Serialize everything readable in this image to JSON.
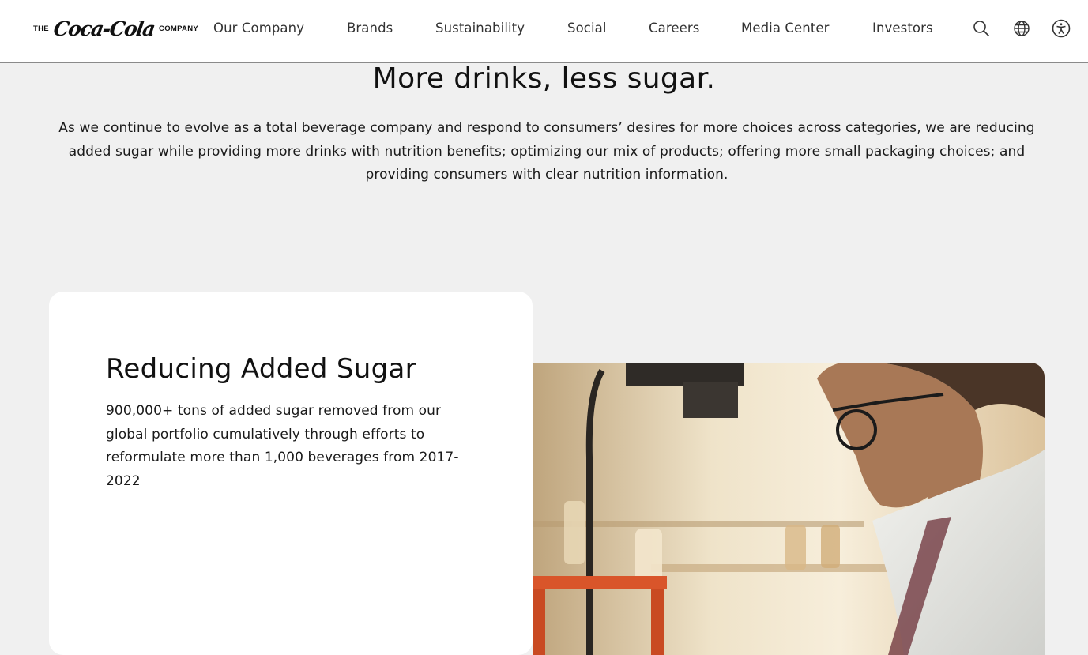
{
  "header": {
    "logo": {
      "prefix": "THE",
      "brand": "Coca-Cola",
      "suffix": "COMPANY"
    },
    "nav": [
      {
        "label": "Our Company"
      },
      {
        "label": "Brands"
      },
      {
        "label": "Sustainability"
      },
      {
        "label": "Social"
      },
      {
        "label": "Careers"
      },
      {
        "label": "Media Center"
      },
      {
        "label": "Investors"
      }
    ],
    "icons": [
      "search-icon",
      "globe-icon",
      "accessibility-icon"
    ]
  },
  "intro": {
    "title": "More drinks, less sugar.",
    "body": "As we continue to evolve as a total beverage company and respond to consumers’ desires for more choices across categories, we are reducing added sugar while providing more drinks with nutrition benefits; optimizing our mix of products; offering more small packaging choices; and providing consumers with clear nutrition information."
  },
  "card": {
    "title": "Reducing Added Sugar",
    "body": "900,000+ tons of added sugar removed from our global portfolio cumulatively through efforts to reformulate more than 1,000 beverages from 2017-2022"
  }
}
